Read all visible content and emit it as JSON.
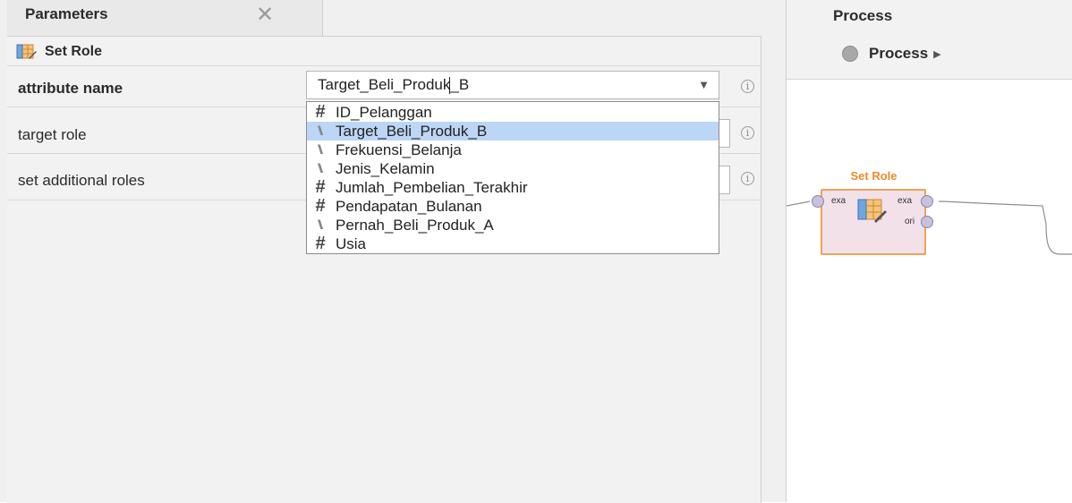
{
  "parameters_panel": {
    "tab_title": "Parameters",
    "close_glyph": "✕",
    "operator_name": "Set Role",
    "operator_icon": "set-role-icon",
    "params": [
      {
        "label": "attribute name",
        "bold": true
      },
      {
        "label": "target role",
        "bold": false
      },
      {
        "label": "set additional roles",
        "bold": false
      }
    ],
    "attribute_combo": {
      "value": "Target_Beli_Produk_B",
      "arrow": "▼"
    },
    "info_glyph": "i",
    "dropdown_options": [
      {
        "type": "numeric",
        "icon": "#",
        "label": "ID_Pelanggan",
        "selected": false
      },
      {
        "type": "nominal",
        "icon": "🙽",
        "label": "Target_Beli_Produk_B",
        "selected": true
      },
      {
        "type": "nominal",
        "icon": "🙽",
        "label": "Frekuensi_Belanja",
        "selected": false
      },
      {
        "type": "nominal",
        "icon": "🙽",
        "label": "Jenis_Kelamin",
        "selected": false
      },
      {
        "type": "numeric",
        "icon": "#",
        "label": "Jumlah_Pembelian_Terakhir",
        "selected": false
      },
      {
        "type": "numeric",
        "icon": "#",
        "label": "Pendapatan_Bulanan",
        "selected": false
      },
      {
        "type": "nominal",
        "icon": "🙽",
        "label": "Pernah_Beli_Produk_A",
        "selected": false
      },
      {
        "type": "numeric",
        "icon": "#",
        "label": "Usia",
        "selected": false
      }
    ],
    "selection_color": "#bcd6f5"
  },
  "process_panel": {
    "title": "Process",
    "breadcrumb_label": "Process",
    "breadcrumb_arrow": "▶",
    "operator": {
      "name": "Set Role",
      "input_port": "exa",
      "output_ports": [
        "exa",
        "ori"
      ],
      "border_color": "#f0a15a",
      "name_color": "#f08a2a"
    }
  }
}
